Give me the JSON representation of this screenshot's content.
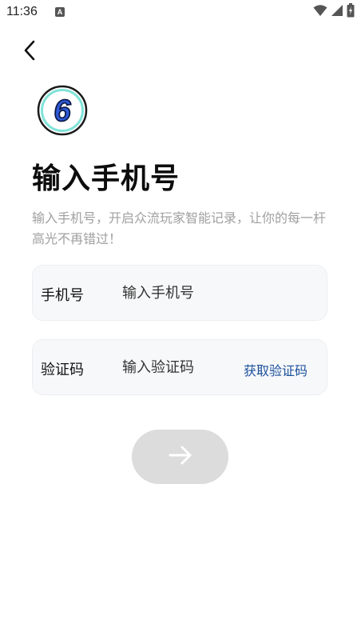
{
  "status_bar": {
    "time": "11:36",
    "app_icon": "A",
    "icons": [
      "wifi-icon",
      "signal-icon",
      "battery-icon"
    ]
  },
  "header": {
    "back_icon": "chevron-left-icon"
  },
  "logo": {
    "text": "6",
    "colors": {
      "fill": "#2d5bd8",
      "ring": "#7fe3d8",
      "outline": "#1a1a1a"
    }
  },
  "title": "输入手机号",
  "subtitle": "输入手机号，开启众流玩家智能记录，让你的每一杆高光不再错过！",
  "form": {
    "phone": {
      "label": "手机号",
      "placeholder": "输入手机号",
      "value": ""
    },
    "code": {
      "label": "验证码",
      "placeholder": "输入验证码",
      "value": "",
      "get_code_label": "获取验证码"
    }
  },
  "submit": {
    "icon": "arrow-right-icon",
    "state": "disabled"
  },
  "colors": {
    "accent": "#1a4f9c",
    "field_bg": "#f7f8fa",
    "button_disabled": "#dcdcdc",
    "subtitle_text": "#a0a0a0"
  }
}
